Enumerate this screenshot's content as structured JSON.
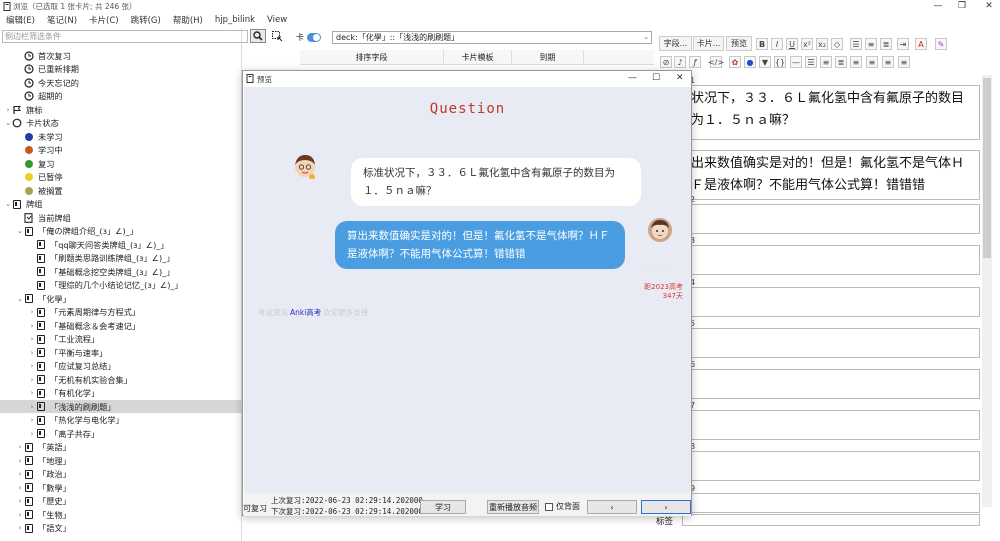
{
  "window": {
    "title": "浏览（已选取 1 张卡片; 共 246 张）",
    "controls": [
      "—",
      "❐",
      "✕"
    ]
  },
  "menu": [
    "编辑(E)",
    "笔记(N)",
    "卡片(C)",
    "跳转(G)",
    "帮助(H)",
    "hjp_bilink",
    "View"
  ],
  "sidebar": {
    "filter_placeholder": "侧边栏筛选条件",
    "items": [
      {
        "label": "首次复习",
        "icon": "clock-icon",
        "indent": 1
      },
      {
        "label": "已重新排期",
        "icon": "clock-icon",
        "indent": 1
      },
      {
        "label": "今天忘记的",
        "icon": "clock-icon",
        "indent": 1
      },
      {
        "label": "超期的",
        "icon": "clock-icon",
        "indent": 1
      },
      {
        "label": "旗标",
        "icon": "flag-icon",
        "indent": 0,
        "arrow": "›"
      },
      {
        "label": "卡片状态",
        "icon": "circle-icon",
        "indent": 0,
        "arrow": "⌄"
      },
      {
        "label": "未学习",
        "icon": "dot",
        "color": "#1f3fa8",
        "indent": 1
      },
      {
        "label": "学习中",
        "icon": "dot",
        "color": "#c85a1a",
        "indent": 1
      },
      {
        "label": "复习",
        "icon": "dot",
        "color": "#2c9a2c",
        "indent": 1
      },
      {
        "label": "已暂停",
        "icon": "dot",
        "color": "#e8d21e",
        "indent": 1
      },
      {
        "label": "被搁置",
        "icon": "dot",
        "color": "#a4a454",
        "indent": 1
      },
      {
        "label": "牌组",
        "icon": "deck-icon",
        "indent": 0,
        "arrow": "⌄"
      },
      {
        "label": "当前牌组",
        "icon": "deck-current-icon",
        "indent": 1
      },
      {
        "label": "「俺の牌组介绍_(з」∠)_」",
        "icon": "deck-icon",
        "indent": 1,
        "arrow": "⌄"
      },
      {
        "label": "「qq聊天问答类牌组_(з」∠)_」",
        "icon": "deck-icon",
        "indent": 2
      },
      {
        "label": "「刷题类思路训练牌组_(з」∠)_」",
        "icon": "deck-icon",
        "indent": 2
      },
      {
        "label": "「基础概念挖空类牌组_(з」∠)_」",
        "icon": "deck-icon",
        "indent": 2
      },
      {
        "label": "「理综的几个小结论记忆_(з」∠)_」",
        "icon": "deck-icon",
        "indent": 2
      },
      {
        "label": "「化學」",
        "icon": "deck-icon",
        "indent": 1,
        "arrow": "⌄"
      },
      {
        "label": "「元素周期律与方程式」",
        "icon": "deck-icon",
        "indent": 2,
        "arrow": "›"
      },
      {
        "label": "「基础概念＆会考速记」",
        "icon": "deck-icon",
        "indent": 2,
        "arrow": "›"
      },
      {
        "label": "「工业流程」",
        "icon": "deck-icon",
        "indent": 2,
        "arrow": "›"
      },
      {
        "label": "「平衡与速率」",
        "icon": "deck-icon",
        "indent": 2,
        "arrow": "›"
      },
      {
        "label": "「应试复习总结」",
        "icon": "deck-icon",
        "indent": 2,
        "arrow": "›"
      },
      {
        "label": "「无机有机实验合集」",
        "icon": "deck-icon",
        "indent": 2,
        "arrow": "›"
      },
      {
        "label": "「有机化学」",
        "icon": "deck-icon",
        "indent": 2,
        "arrow": "›"
      },
      {
        "label": "「浅浅的刷刷题」",
        "icon": "deck-icon",
        "indent": 2,
        "arrow": "›",
        "selected": true
      },
      {
        "label": "「热化学与电化学」",
        "icon": "deck-icon",
        "indent": 2,
        "arrow": "›"
      },
      {
        "label": "「离子共存」",
        "icon": "deck-icon",
        "indent": 2,
        "arrow": "›"
      },
      {
        "label": "「英語」",
        "icon": "deck-icon",
        "indent": 1,
        "arrow": "›"
      },
      {
        "label": "「地理」",
        "icon": "deck-icon",
        "indent": 1,
        "arrow": "›"
      },
      {
        "label": "「政治」",
        "icon": "deck-icon",
        "indent": 1,
        "arrow": "›"
      },
      {
        "label": "「數學」",
        "icon": "deck-icon",
        "indent": 1,
        "arrow": "›"
      },
      {
        "label": "「歷史」",
        "icon": "deck-icon",
        "indent": 1,
        "arrow": "›"
      },
      {
        "label": "「生物」",
        "icon": "deck-icon",
        "indent": 1,
        "arrow": "›"
      },
      {
        "label": "「語文」",
        "icon": "deck-icon",
        "indent": 1,
        "arrow": "›"
      }
    ]
  },
  "search": {
    "toggle_label": "卡",
    "query": "deck:「化學」::「浅浅的刷刷题」"
  },
  "table": {
    "columns": [
      "排序字段",
      "卡片模板",
      "到期"
    ]
  },
  "editor": {
    "buttons": [
      "字段...",
      "卡片...",
      "预览"
    ],
    "fields": [
      {
        "num": "1",
        "text": "状况下，３３．６Ｌ氟化氢中含有氟原子的数目为１．５ｎａ嘛？"
      },
      {
        "num": "",
        "text": "出来数值确实是对的！但是！氟化氢不是气体ＨＦ是液体啊？不能用气体公式算！错错错"
      },
      {
        "num": "2",
        "text": ""
      },
      {
        "num": "3",
        "text": ""
      },
      {
        "num": "4",
        "text": ""
      },
      {
        "num": "5",
        "text": ""
      },
      {
        "num": "6",
        "text": ""
      },
      {
        "num": "7",
        "text": ""
      },
      {
        "num": "8",
        "text": ""
      },
      {
        "num": "9",
        "text": ""
      }
    ],
    "tags_label": "标签"
  },
  "preview": {
    "title": "预览",
    "heading": "Question",
    "question": "标准状况下，３３．６Ｌ氟化氢中含有氟原子的数目为１．５ｎａ嘛？",
    "answer": "算出来数值确实是对的！但是！氟化氢不是气体啊？ＨＦ是液体啊？不能用气体公式算！错错错",
    "countdown_label": "距2023高考",
    "countdown_days": "347天",
    "footer_left": "考试资讯",
    "footer_link": "Anki高考",
    "footer_right": "欢迎更多支持",
    "bottom": {
      "review_label": "可复习",
      "last_review_1": "上次复习:2022-06-23 02:29:14.202000",
      "last_review_2": "下次复习:2022-06-23 02:29:14.202000",
      "learn_button": "学习",
      "replay_button": "重新播放音频",
      "back_only_label": "仅背面",
      "prev_label": "‹",
      "next_label": "›"
    }
  },
  "colors": {
    "heading": "#c0392b",
    "answer_bubble": "#4a9de0",
    "selected_row": "#d6d6d6",
    "preview_bg": "#e8ebf3"
  }
}
